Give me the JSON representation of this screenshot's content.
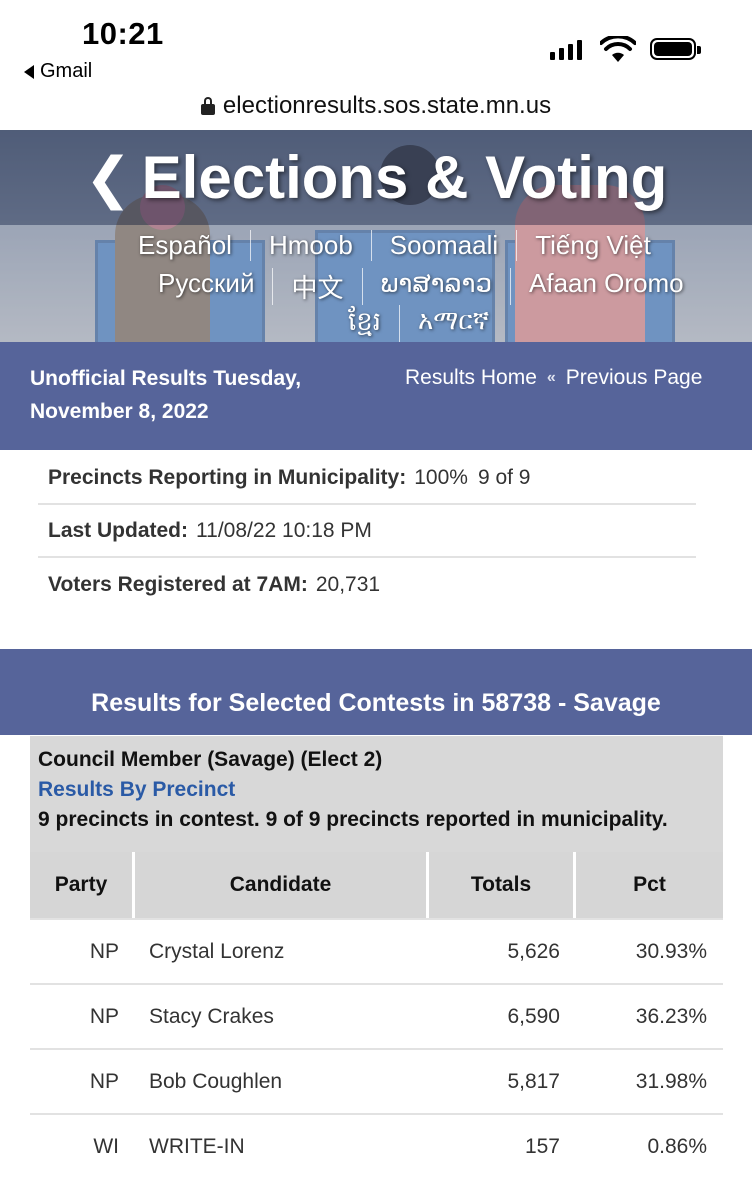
{
  "status_bar": {
    "time": "10:21",
    "back_app": "Gmail"
  },
  "browser": {
    "url": "electionresults.sos.state.mn.us"
  },
  "banner": {
    "title": "Elections & Voting",
    "languages_row1": [
      "Español",
      "Hmoob",
      "Soomaali",
      "Tiếng Việt"
    ],
    "languages_row2": [
      "Русский",
      "中文",
      "ພາສາລາວ",
      "Afaan Oromo"
    ],
    "languages_row3": [
      "ខ្មែរ",
      "አማርኛ"
    ]
  },
  "header": {
    "title": "Unofficial Results Tuesday, November 8, 2022",
    "results_home": "Results Home",
    "separator": "«",
    "previous_page": "Previous Page"
  },
  "info": {
    "precincts_label": "Precincts Reporting in Municipality:",
    "precincts_pct": "100%",
    "precincts_count": "9 of 9",
    "updated_label": "Last Updated:",
    "updated_value": "11/08/22 10:18 PM",
    "registered_label": "Voters Registered at 7AM:",
    "registered_value": "20,731"
  },
  "results_header": "Results for Selected Contests in 58738 - Savage",
  "contest": {
    "name": "Council Member (Savage) (Elect 2)",
    "link": "Results By Precinct",
    "note": "9 precincts in contest. 9 of 9 precincts reported in municipality."
  },
  "table": {
    "headers": {
      "party": "Party",
      "candidate": "Candidate",
      "totals": "Totals",
      "pct": "Pct"
    },
    "rows": [
      {
        "party": "NP",
        "candidate": "Crystal Lorenz",
        "totals": "5,626",
        "pct": "30.93%"
      },
      {
        "party": "NP",
        "candidate": "Stacy Crakes",
        "totals": "6,590",
        "pct": "36.23%"
      },
      {
        "party": "NP",
        "candidate": "Bob Coughlen",
        "totals": "5,817",
        "pct": "31.98%"
      },
      {
        "party": "WI",
        "candidate": "WRITE-IN",
        "totals": "157",
        "pct": "0.86%"
      }
    ]
  }
}
